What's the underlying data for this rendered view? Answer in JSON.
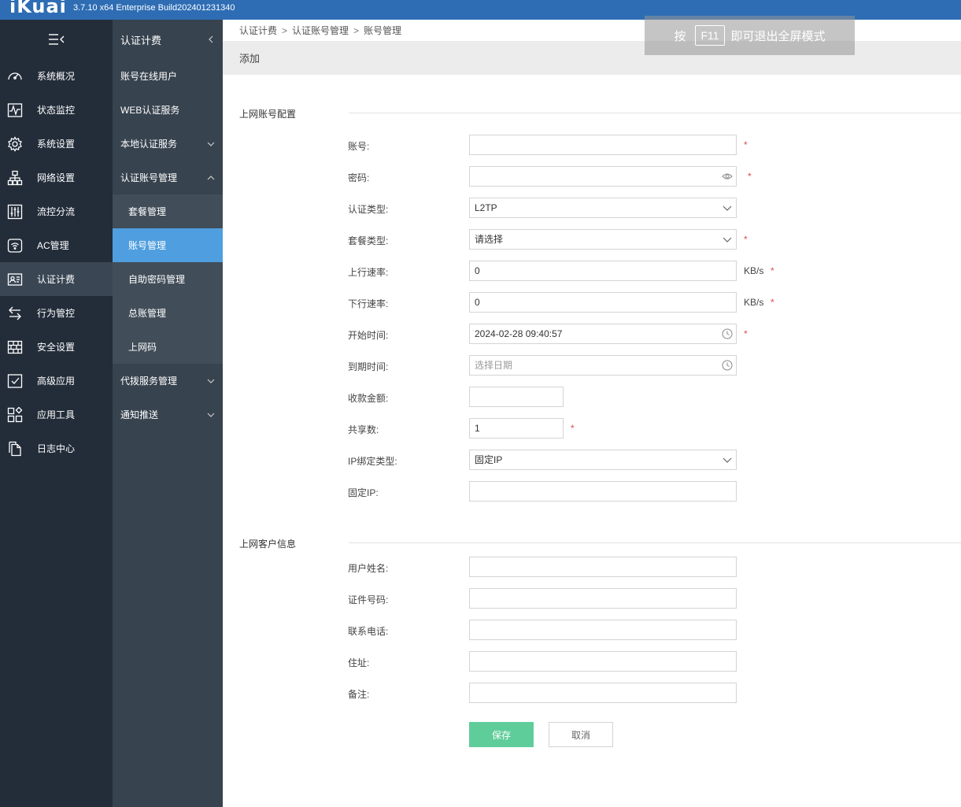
{
  "topbar": {
    "logo": "iKuai",
    "version": "3.7.10 x64 Enterprise Build202401231340"
  },
  "sidebar_primary": {
    "items": [
      {
        "label": "系统概况",
        "icon": "dashboard-icon"
      },
      {
        "label": "状态监控",
        "icon": "pulse-monitor-icon"
      },
      {
        "label": "系统设置",
        "icon": "gear-icon"
      },
      {
        "label": "网络设置",
        "icon": "network-icon"
      },
      {
        "label": "流控分流",
        "icon": "sliders-icon"
      },
      {
        "label": "AC管理",
        "icon": "wifi-router-icon"
      },
      {
        "label": "认证计费",
        "icon": "id-card-icon"
      },
      {
        "label": "行为管控",
        "icon": "swap-arrows-icon"
      },
      {
        "label": "安全设置",
        "icon": "firewall-icon"
      },
      {
        "label": "高级应用",
        "icon": "checkbox-board-icon"
      },
      {
        "label": "应用工具",
        "icon": "apps-grid-icon"
      },
      {
        "label": "日志中心",
        "icon": "document-copy-icon"
      }
    ],
    "active_index": 6
  },
  "sidebar_secondary": {
    "title": "认证计费",
    "items": [
      {
        "label": "账号在线用户"
      },
      {
        "label": "WEB认证服务"
      },
      {
        "label": "本地认证服务"
      },
      {
        "label": "认证账号管理"
      },
      {
        "label": "套餐管理"
      },
      {
        "label": "账号管理"
      },
      {
        "label": "自助密码管理"
      },
      {
        "label": "总账管理"
      },
      {
        "label": "上网码"
      },
      {
        "label": "代拨服务管理"
      },
      {
        "label": "通知推送"
      }
    ]
  },
  "breadcrumb": {
    "level1": "认证计费",
    "level2": "认证账号管理",
    "level3": "账号管理",
    "separator": ">"
  },
  "subheader": {
    "title": "添加"
  },
  "fullscreen_tip": {
    "prefix": "按",
    "key": "F11",
    "suffix": "即可退出全屏模式"
  },
  "section_account": {
    "title": "上网账号配置",
    "fields": {
      "account": {
        "label": "账号:",
        "value": "",
        "required": "*"
      },
      "password": {
        "label": "密码:",
        "value": "",
        "required": "*"
      },
      "auth_type": {
        "label": "认证类型:",
        "value": "L2TP"
      },
      "package_type": {
        "label": "套餐类型:",
        "value": "请选择",
        "required": "*"
      },
      "upload_rate": {
        "label": "上行速率:",
        "value": "0",
        "unit": "KB/s",
        "required": "*"
      },
      "download_rate": {
        "label": "下行速率:",
        "value": "0",
        "unit": "KB/s",
        "required": "*"
      },
      "start_time": {
        "label": "开始时间:",
        "value": "2024-02-28 09:40:57",
        "required": "*"
      },
      "expire_time": {
        "label": "到期时间:",
        "placeholder": "选择日期"
      },
      "amount": {
        "label": "收款金额:",
        "value": ""
      },
      "share_count": {
        "label": "共享数:",
        "value": "1",
        "required": "*"
      },
      "ip_bind_type": {
        "label": "IP绑定类型:",
        "value": "固定IP"
      },
      "fixed_ip": {
        "label": "固定IP:",
        "value": ""
      }
    }
  },
  "section_customer": {
    "title": "上网客户信息",
    "fields": {
      "user_name": {
        "label": "用户姓名:",
        "value": ""
      },
      "id_number": {
        "label": "证件号码:",
        "value": ""
      },
      "phone": {
        "label": "联系电话:",
        "value": ""
      },
      "address": {
        "label": "住址:",
        "value": ""
      },
      "remark": {
        "label": "备注:",
        "value": ""
      }
    }
  },
  "actions": {
    "save": "保存",
    "cancel": "取消"
  },
  "colors": {
    "topbar": "#2e6db4",
    "sidebar_primary": "#232d3a",
    "sidebar_secondary": "#37434f",
    "active_item": "#4f9edf",
    "save_button": "#5fcd9a",
    "required": "#e04b4b"
  }
}
